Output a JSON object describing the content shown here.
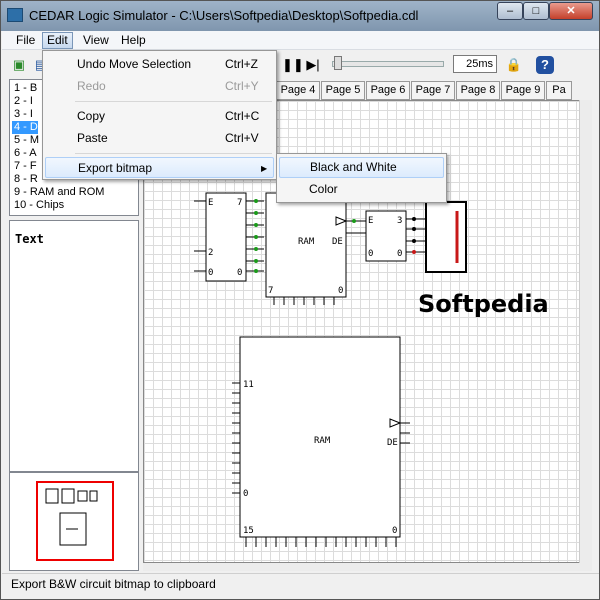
{
  "window": {
    "title": "CEDAR Logic Simulator - C:\\Users\\Softpedia\\Desktop\\Softpedia.cdl",
    "minimize_label": "–",
    "maximize_label": "□",
    "close_label": "✕"
  },
  "menubar": {
    "items": [
      {
        "label": "File"
      },
      {
        "label": "Edit"
      },
      {
        "label": "View"
      },
      {
        "label": "Help"
      }
    ]
  },
  "edit_menu": {
    "items": [
      {
        "label": "Undo Move Selection",
        "shortcut": "Ctrl+Z",
        "enabled": true
      },
      {
        "label": "Redo",
        "shortcut": "Ctrl+Y",
        "enabled": false
      },
      {
        "label": "Copy",
        "shortcut": "Ctrl+C",
        "enabled": true
      },
      {
        "label": "Paste",
        "shortcut": "Ctrl+V",
        "enabled": true
      },
      {
        "label": "Export bitmap",
        "submenu_arrow": "▶",
        "enabled": true
      }
    ]
  },
  "export_submenu": {
    "items": [
      {
        "label": "Black and White"
      },
      {
        "label": "Color"
      }
    ]
  },
  "toolbar": {
    "speed_value": "25ms"
  },
  "library_list": {
    "items": [
      {
        "label": "1 - B"
      },
      {
        "label": "2 - I"
      },
      {
        "label": "3 - I"
      },
      {
        "label": "4 - D"
      },
      {
        "label": "5 - M"
      },
      {
        "label": "6 - A"
      },
      {
        "label": "7 - F"
      },
      {
        "label": "8 - R"
      },
      {
        "label": "9 - RAM and ROM"
      },
      {
        "label": "10 - Chips"
      }
    ],
    "selected_index": 3
  },
  "text_panel": {
    "label": "Text"
  },
  "tabs": {
    "items": [
      {
        "label": "Page 4"
      },
      {
        "label": "Page 5"
      },
      {
        "label": "Page 6"
      },
      {
        "label": "Page 7"
      },
      {
        "label": "Page 8"
      },
      {
        "label": "Page 9"
      },
      {
        "label": "Pa"
      }
    ]
  },
  "canvas": {
    "watermark": "Softpedia",
    "upper_left_chip": {
      "top_left": "E",
      "top_right": "7",
      "mid_left": "2",
      "bottom_left": "0",
      "bottom_right": "0"
    },
    "ram_small": {
      "label": "RAM",
      "pin_de": "DE",
      "bottom_left": "7",
      "bottom_right": "0"
    },
    "right_chip": {
      "top_left": "E",
      "top_right": "3",
      "bottom_left": "0",
      "bottom_right": "0"
    },
    "ram_large": {
      "label": "RAM",
      "pin_11": "11",
      "pin_de": "DE",
      "pin_0": "0",
      "bottom_left": "15",
      "bottom_right": "0"
    }
  },
  "statusbar": {
    "message": "Export B&W circuit bitmap to clipboard"
  }
}
